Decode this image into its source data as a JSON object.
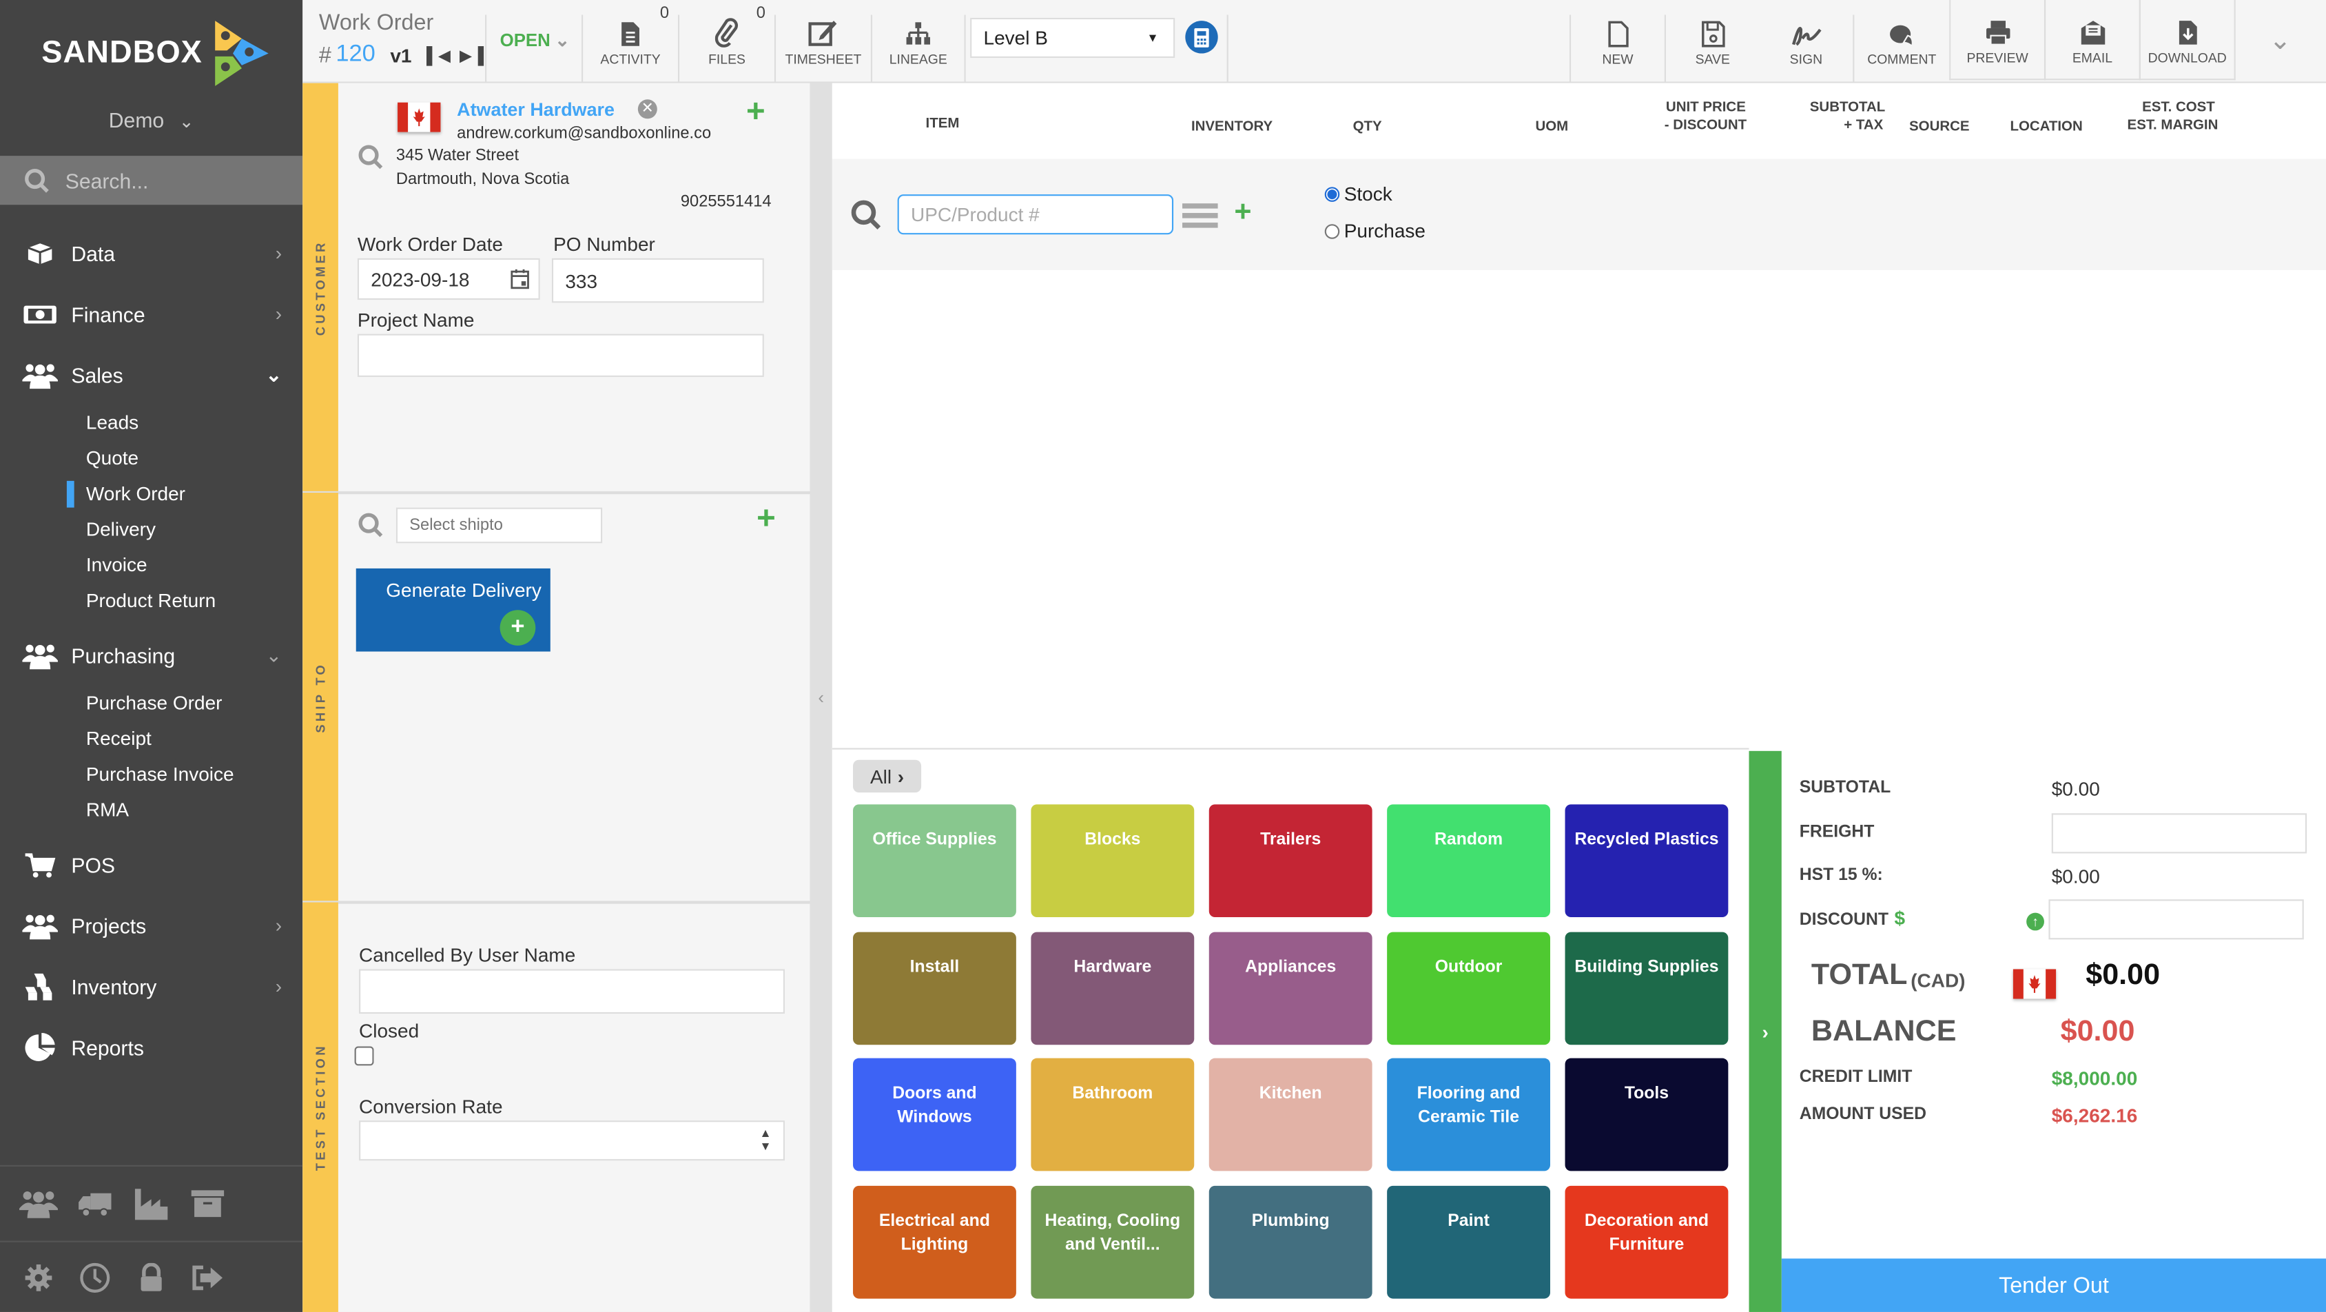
{
  "sidebar": {
    "logo_text": "SANDBOX",
    "org": "Demo",
    "search_placeholder": "Search...",
    "items": [
      {
        "label": "Data",
        "icon": "cube-icon",
        "arrow": "›"
      },
      {
        "label": "Finance",
        "icon": "money-icon",
        "arrow": "›"
      },
      {
        "label": "Sales",
        "icon": "users-icon",
        "arrow": "⌄"
      },
      {
        "label": "Purchasing",
        "icon": "users-icon",
        "arrow": "⌄"
      },
      {
        "label": "POS",
        "icon": "cart-icon"
      },
      {
        "label": "Projects",
        "icon": "users-icon",
        "arrow": "›"
      },
      {
        "label": "Inventory",
        "icon": "boxes-icon",
        "arrow": "›"
      },
      {
        "label": "Reports",
        "icon": "pie-chart-icon"
      }
    ],
    "sales_sub": [
      "Leads",
      "Quote",
      "Work Order",
      "Delivery",
      "Invoice",
      "Product Return"
    ],
    "sales_active": "Work Order",
    "purchasing_sub": [
      "Purchase Order",
      "Receipt",
      "Purchase Invoice",
      "RMA"
    ],
    "bottom_icons_1": [
      "contacts-icon",
      "truck-icon",
      "factory-icon",
      "archive-icon"
    ],
    "bottom_icons_2": [
      "gear-icon",
      "clock-icon",
      "lock-icon",
      "logout-icon"
    ]
  },
  "toolbar": {
    "doc_type": "Work Order",
    "hash": "#",
    "number": "120",
    "version": "v1",
    "status": "OPEN",
    "activity": {
      "label": "ACTIVITY",
      "count": "0"
    },
    "files": {
      "label": "FILES",
      "count": "0"
    },
    "timesheet": "TIMESHEET",
    "lineage": "LINEAGE",
    "price_level": "Level B",
    "new": "NEW",
    "save": "SAVE",
    "sign": "SIGN",
    "comment": "COMMENT",
    "preview": "PREVIEW",
    "email": "EMAIL",
    "download": "DOWNLOAD"
  },
  "customer": {
    "section_label": "CUSTOMER",
    "name": "Atwater Hardware",
    "email": "andrew.corkum@sandboxonline.co",
    "address1": "345 Water Street",
    "address2": "Dartmouth, Nova Scotia",
    "phone": "9025551414",
    "work_order_date_label": "Work Order Date",
    "work_order_date": "2023-09-18",
    "po_number_label": "PO Number",
    "po_number": "333",
    "project_name_label": "Project Name",
    "project_name": ""
  },
  "shipto": {
    "section_label": "SHIP TO",
    "placeholder": "Select shipto",
    "generate_delivery": "Generate Delivery"
  },
  "test_section": {
    "section_label": "TEST SECTION",
    "cancelled_by_label": "Cancelled By User Name",
    "cancelled_by": "",
    "closed_label": "Closed",
    "closed": false,
    "conversion_rate_label": "Conversion Rate",
    "conversion_rate": ""
  },
  "lines": {
    "columns": {
      "item": "ITEM",
      "inventory": "INVENTORY",
      "qty": "QTY",
      "uom": "UOM",
      "unit_price_1": "UNIT PRICE",
      "unit_price_2": "- DISCOUNT",
      "subtotal_1": "SUBTOTAL",
      "subtotal_2": "+ TAX",
      "source": "SOURCE",
      "location": "LOCATION",
      "est_1": "EST. COST",
      "est_2": "EST. MARGIN"
    },
    "upc_placeholder": "UPC/Product #",
    "mode_options": [
      "Stock",
      "Purchase"
    ],
    "mode_selected": "Stock"
  },
  "catalog": {
    "breadcrumb": "All",
    "categories": [
      {
        "label": "Office Supplies",
        "color": "#88c78e"
      },
      {
        "label": "Blocks",
        "color": "#c8cd42"
      },
      {
        "label": "Trailers",
        "color": "#c42534"
      },
      {
        "label": "Random",
        "color": "#42e06f"
      },
      {
        "label": "Recycled Plastics",
        "color": "#2522b0"
      },
      {
        "label": "Install",
        "color": "#8e7a36"
      },
      {
        "label": "Hardware",
        "color": "#835977"
      },
      {
        "label": "Appliances",
        "color": "#985d8b"
      },
      {
        "label": "Outdoor",
        "color": "#4fc931"
      },
      {
        "label": "Building Supplies",
        "color": "#1d6a4a"
      },
      {
        "label": "Doors and Windows",
        "color": "#3d63f5"
      },
      {
        "label": "Bathroom",
        "color": "#e2af42"
      },
      {
        "label": "Kitchen",
        "color": "#e2b2a6"
      },
      {
        "label": "Flooring and Ceramic Tile",
        "color": "#2b8fda"
      },
      {
        "label": "Tools",
        "color": "#0a0a30"
      },
      {
        "label": "Electrical and Lighting",
        "color": "#d05e1c"
      },
      {
        "label": "Heating, Cooling and Ventil...",
        "color": "#719a54"
      },
      {
        "label": "Plumbing",
        "color": "#436f80"
      },
      {
        "label": "Paint",
        "color": "#216677"
      },
      {
        "label": "Decoration and Furniture",
        "color": "#e5381e"
      }
    ]
  },
  "summary": {
    "subtotal_label": "SUBTOTAL",
    "subtotal": "$0.00",
    "freight_label": "FREIGHT",
    "freight": "",
    "tax_label": "HST 15 %:",
    "tax": "$0.00",
    "discount_label": "DISCOUNT",
    "discount_currency": "$",
    "discount": "",
    "total_label": "TOTAL",
    "total_currency": "(CAD)",
    "total": "$0.00",
    "balance_label": "BALANCE",
    "balance": "$0.00",
    "credit_limit_label": "CREDIT LIMIT",
    "credit_limit": "$8,000.00",
    "amount_used_label": "AMOUNT USED",
    "amount_used": "$6,262.16",
    "tender_out": "Tender Out"
  },
  "colors": {
    "accent_blue": "#42a5f5",
    "green": "#4caf50",
    "red": "#d9534f",
    "section_tab": "#f9c74f",
    "sidebar_bg": "#444444"
  }
}
